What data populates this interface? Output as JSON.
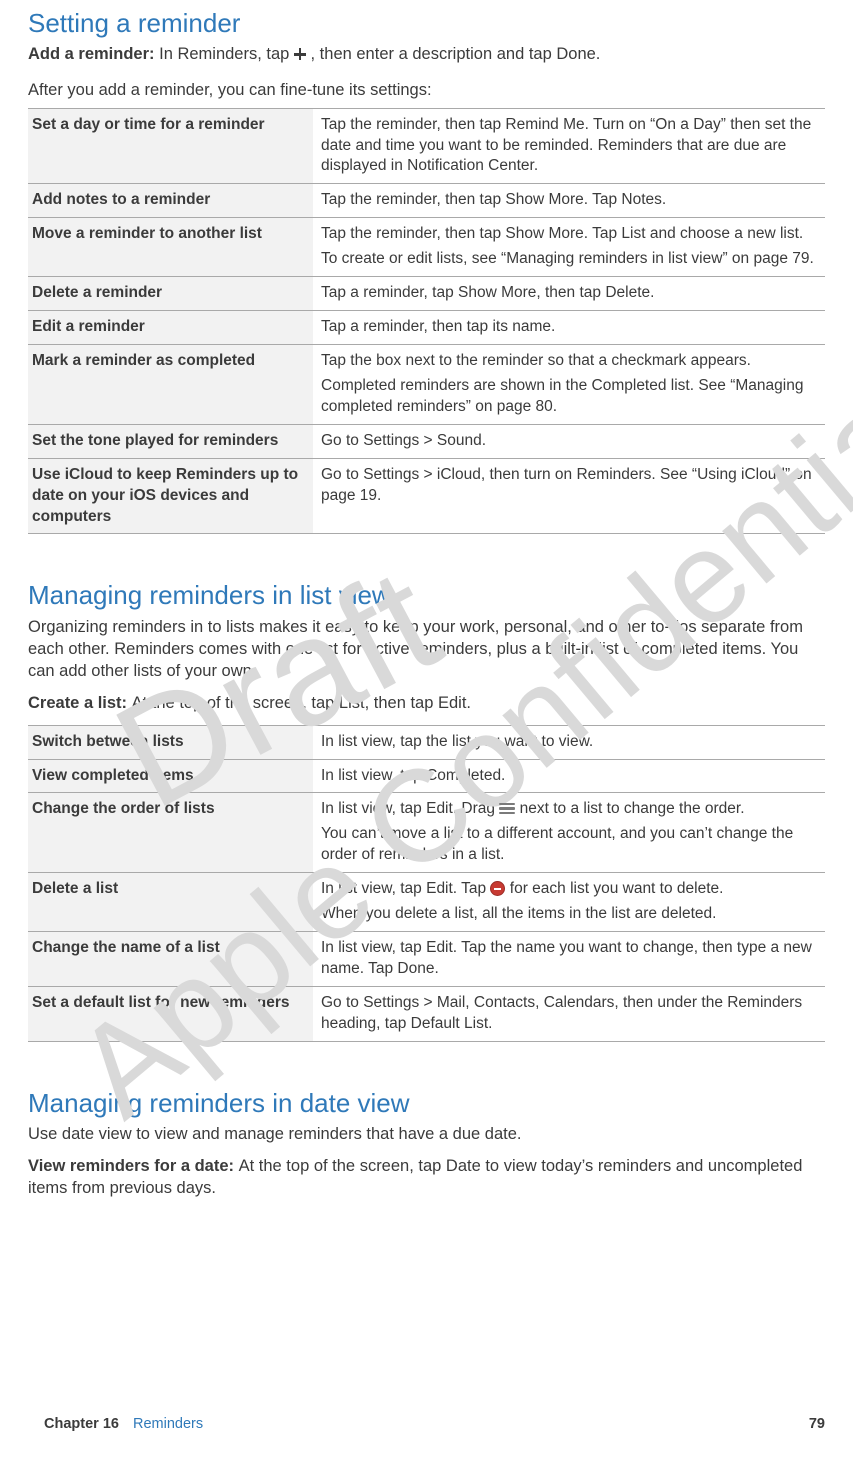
{
  "watermark": {
    "draft": "Draft",
    "confidential": "Apple Confidential"
  },
  "section1": {
    "heading": "Setting a reminder",
    "add_label": "Add a reminder:  ",
    "add_text_a": "In Reminders, tap ",
    "add_text_b": ", then enter a description and tap Done.",
    "after": "After you add a reminder, you can fine-tune its settings:",
    "rows": [
      {
        "l": "Set a day or time for a reminder",
        "r": [
          "Tap the reminder, then tap Remind Me. Turn on “On a Day” then set the date and time you want to be reminded. Reminders that are due are displayed in Notification Center."
        ]
      },
      {
        "l": "Add notes to a reminder",
        "r": [
          "Tap the reminder, then tap Show More. Tap Notes."
        ]
      },
      {
        "l": "Move a reminder to another list",
        "r": [
          "Tap the reminder, then tap Show More. Tap List and choose a new list.",
          "To create or edit lists, see “Managing reminders in list view” on page 79."
        ]
      },
      {
        "l": "Delete a reminder",
        "r": [
          "Tap a reminder, tap Show More, then tap Delete."
        ]
      },
      {
        "l": "Edit a reminder",
        "r": [
          "Tap a reminder, then tap its name."
        ]
      },
      {
        "l": "Mark a reminder as completed",
        "r": [
          "Tap the box next to the reminder so that a checkmark appears.",
          "Completed reminders are shown in the Completed list. See “Managing completed reminders” on page 80."
        ]
      },
      {
        "l": "Set the tone played for reminders",
        "r": [
          "Go to Settings > Sound."
        ]
      },
      {
        "l": "Use iCloud to keep Reminders up to date on your iOS devices and computers",
        "r": [
          "Go to Settings > iCloud, then turn on Reminders. See “Using iCloud” on page 19."
        ]
      }
    ]
  },
  "section2": {
    "heading": "Managing reminders in list view",
    "intro": "Organizing reminders in to lists makes it easy to keep your work, personal, and other to-dos separate from each other. Reminders comes with one list for active reminders, plus a built-in list of completed items. You can add other lists of your own.",
    "create_label": "Create a list:  ",
    "create_text": "At the top of the screen, tap List, then tap Edit.",
    "rows": [
      {
        "l": "Switch between lists",
        "r": [
          "In list view, tap the list you want to view."
        ]
      },
      {
        "l": "View completed items",
        "r": [
          "In list view, tap Completed."
        ]
      },
      {
        "l": "Change the order of lists",
        "r_drag_a": "In list view, tap Edit. Drag ",
        "r_drag_b": " next to a list to change the order.",
        "r2": "You can’t move a list to a different account, and you can’t change the order of reminders in a list."
      },
      {
        "l": "Delete a list",
        "r_del_a": "In list view, tap Edit. Tap ",
        "r_del_b": " for each list you want to delete.",
        "r2": "When you delete a list, all the items in the list are deleted."
      },
      {
        "l": "Change the name of a list",
        "r": [
          "In list view, tap Edit. Tap the name you want to change, then type a new name. Tap Done."
        ]
      },
      {
        "l": "Set a default list for new reminders",
        "r": [
          "Go to Settings > Mail, Contacts, Calendars, then under the Reminders heading, tap Default List."
        ]
      }
    ]
  },
  "section3": {
    "heading": "Managing reminders in date view",
    "intro": "Use date view to view and manage reminders that have a due date.",
    "view_label": "View reminders for a date:  ",
    "view_text": "At the top of the screen, tap Date to view today’s reminders and uncompleted items from previous days."
  },
  "footer": {
    "chapter": "Chapter 16",
    "title": "Reminders",
    "page": "79"
  }
}
